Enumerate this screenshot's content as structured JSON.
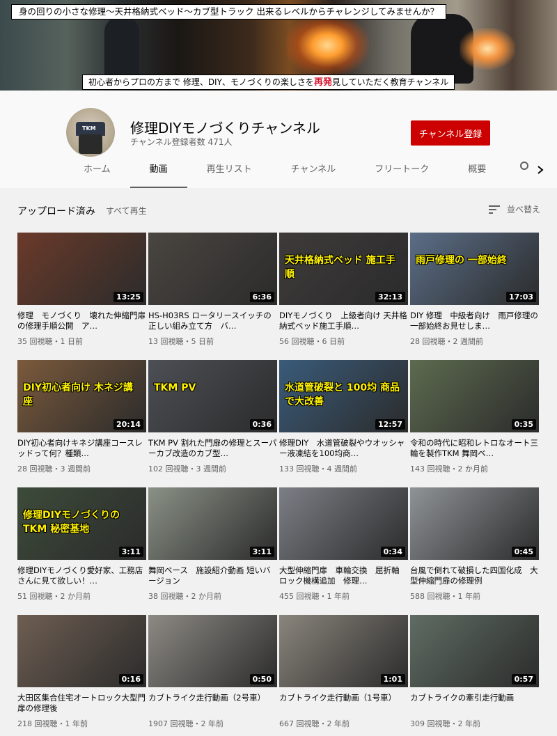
{
  "banner": {
    "top_caption": "身の回りの小さな修理～天井格納式ベッド～カブ型トラック 出来るレベルからチャレンジしてみませんか？",
    "bottom_caption_before": "初心者からプロの方まで 修理、DIY、モノづくりの楽しさを",
    "bottom_caption_highlight_1": "再発",
    "bottom_caption_middle": "見",
    "bottom_caption_after": "していただく教育チャンネル"
  },
  "channel": {
    "name": "修理DIYモノづくりチャンネル",
    "subscribers": "チャンネル登録者数 471人",
    "subscribe_label": "チャンネル登録",
    "avatar_text": "TKM"
  },
  "tabs": [
    {
      "label": "ホーム",
      "active": false
    },
    {
      "label": "動画",
      "active": true
    },
    {
      "label": "再生リスト",
      "active": false
    },
    {
      "label": "チャンネル",
      "active": false
    },
    {
      "label": "フリートーク",
      "active": false
    },
    {
      "label": "概要",
      "active": false
    }
  ],
  "section": {
    "title": "アップロード済み",
    "play_all": "すべて再生",
    "sort_label": "並べ替え"
  },
  "videos": [
    {
      "title": "修理　モノづくり　壊れた伸縮門扉の修理手順公開　ア…",
      "meta": "35 回視聴・1 日前",
      "duration": "13:25",
      "thumb_text": "",
      "bg": "#6b3a2a"
    },
    {
      "title": "HS-H03RS ロータリースイッチの正しい組み立て方　バ…",
      "meta": "13 回視聴・5 日前",
      "duration": "6:36",
      "thumb_text": "",
      "bg": "#4a4540"
    },
    {
      "title": "DIYモノづくり　上級者向け 天井格納式ベッド施工手順…",
      "meta": "56 回視聴・6 日前",
      "duration": "32:13",
      "thumb_text": "天井格納式ベッド 施工手順",
      "bg": "#3e3a3a"
    },
    {
      "title": "DIY 修理　中級者向け　雨戸修理の一部始終お見せしま…",
      "meta": "28 回視聴・2 週間前",
      "duration": "17:03",
      "thumb_text": "雨戸修理の 一部始終",
      "bg": "#5b6e88"
    },
    {
      "title": "DIY初心者向けキネジ講座コースレッドって何？種類…",
      "meta": "28 回視聴・3 週間前",
      "duration": "20:14",
      "thumb_text": "DIY初心者向け 木ネジ講座",
      "bg": "#7b5a3c"
    },
    {
      "title": "TKM PV 割れた門扉の修理とスーパーカブ改造のカブ型…",
      "meta": "102 回視聴・3 週間前",
      "duration": "0:36",
      "thumb_text": "TKM PV",
      "bg": "#4c4f55"
    },
    {
      "title": "修理DIY　水道管破裂やウオッシャー液凍結を100均商…",
      "meta": "133 回視聴・4 週間前",
      "duration": "12:57",
      "thumb_text": "水道管破裂と 100均 商品で大改善",
      "bg": "#3a5b7a"
    },
    {
      "title": "令和の時代に昭和レトロなオート三輪を製作TKM 舞岡ベ…",
      "meta": "143 回視聴・2 か月前",
      "duration": "0:35",
      "thumb_text": "",
      "bg": "#5d6b4f"
    },
    {
      "title": "修理DIYモノづくり愛好家、工務店さんに見て欲しい！…",
      "meta": "51 回視聴・2 か月前",
      "duration": "3:11",
      "thumb_text": "修理DIYモノづくりの TKM 秘密基地",
      "bg": "#3d4b3a"
    },
    {
      "title": "舞岡ベース　施設紹介動画 短いバージョン",
      "meta": "38 回視聴・2 か月前",
      "duration": "3:11",
      "thumb_text": "",
      "bg": "#8a9186"
    },
    {
      "title": "大型伸縮門扉　車輪交換　屈折軸　ロック機構追加　修理…",
      "meta": "455 回視聴・1 年前",
      "duration": "0:34",
      "thumb_text": "",
      "bg": "#7c7f86"
    },
    {
      "title": "台風で倒れて破損した四国化成　大型伸縮門扉の修理例",
      "meta": "588 回視聴・1 年前",
      "duration": "0:45",
      "thumb_text": "",
      "bg": "#8f9397"
    },
    {
      "title": "大田区集合住宅オートロック大型門扉の修理後",
      "meta": "218 回視聴・1 年前",
      "duration": "0:16",
      "thumb_text": "",
      "bg": "#6e5e52"
    },
    {
      "title": "カブトライク走行動画（2号車）",
      "meta": "1907 回視聴・2 年前",
      "duration": "0:50",
      "thumb_text": "",
      "bg": "#8d8a84"
    },
    {
      "title": "カブトライク走行動画（1号車）",
      "meta": "667 回視聴・2 年前",
      "duration": "1:01",
      "thumb_text": "",
      "bg": "#8a857c"
    },
    {
      "title": "カブトライクの牽引走行動画",
      "meta": "309 回視聴・2 年前",
      "duration": "0:57",
      "thumb_text": "",
      "bg": "#5f6d63"
    }
  ]
}
